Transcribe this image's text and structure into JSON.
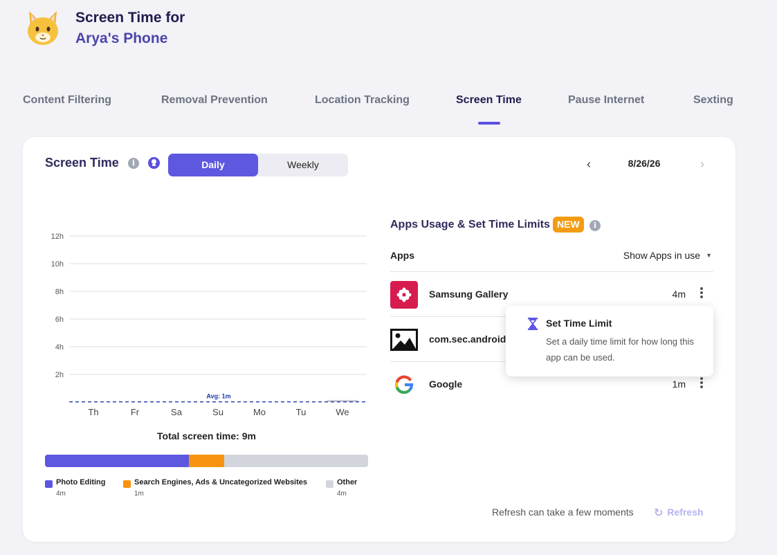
{
  "header": {
    "title_prefix": "Screen Time for",
    "device_name": "Arya's Phone",
    "avatar_icon": "cat-face-icon"
  },
  "tabs": [
    {
      "label": "Content Filtering",
      "active": false
    },
    {
      "label": "Removal Prevention",
      "active": false
    },
    {
      "label": "Location Tracking",
      "active": false
    },
    {
      "label": "Screen Time",
      "active": true
    },
    {
      "label": "Pause Internet",
      "active": false
    },
    {
      "label": "Sexting",
      "active": false
    }
  ],
  "screen_time": {
    "title": "Screen Time",
    "toggle": {
      "daily": "Daily",
      "weekly": "Weekly",
      "selected": "Daily"
    },
    "date": "8/26/26"
  },
  "chart_data": {
    "type": "bar",
    "categories": [
      "Th",
      "Fr",
      "Sa",
      "Su",
      "Mo",
      "Tu",
      "We"
    ],
    "values_minutes": [
      0,
      0,
      0,
      0,
      0,
      0,
      9
    ],
    "y_tick_labels": [
      "2h",
      "4h",
      "6h",
      "8h",
      "10h",
      "12h"
    ],
    "ylim_hours": [
      0,
      12
    ],
    "average_label": "Avg: 1m",
    "average_minutes": 1,
    "grid": true
  },
  "total": {
    "label": "Total screen time: 9m"
  },
  "categories_bar": [
    {
      "name": "Photo Editing",
      "value": "4m",
      "minutes": 4,
      "color": "#5e57e0"
    },
    {
      "name": "Search Engines, Ads & Uncategorized Websites",
      "value": "1m",
      "minutes": 1,
      "color": "#f7930f"
    },
    {
      "name": "Other",
      "value": "4m",
      "minutes": 4,
      "color": "#d2d6dc"
    }
  ],
  "apps_panel": {
    "title": "Apps Usage & Set Time Limits",
    "badge": "NEW",
    "column_label": "Apps",
    "filter_label": "Show Apps in use",
    "apps": [
      {
        "name": "Samsung Gallery",
        "time": "4m",
        "icon": "samsung-gallery-icon"
      },
      {
        "name": "com.sec.android",
        "time": "",
        "icon": "image-placeholder-icon"
      },
      {
        "name": "Google",
        "time": "1m",
        "icon": "google-icon"
      }
    ]
  },
  "popover": {
    "title": "Set Time Limit",
    "description": "Set a daily time limit for how long this app can be used.",
    "icon": "hourglass-icon"
  },
  "refresh": {
    "note": "Refresh can take a few moments",
    "button": "Refresh"
  },
  "colors": {
    "accent": "#5e57e0",
    "orange": "#f7930f",
    "badge": "#f39c12",
    "grey": "#d2d6dc",
    "avg_line": "#1a3aa6"
  }
}
